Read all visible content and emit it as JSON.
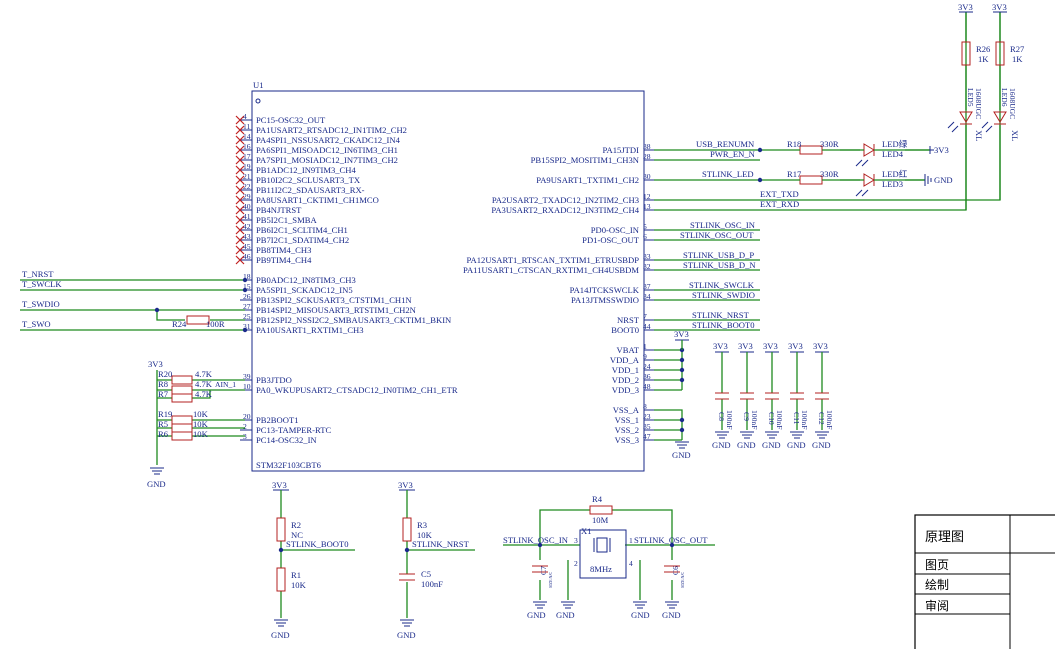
{
  "u1": {
    "ref": "U1",
    "part": "STM32F103CBT6",
    "left_pins": [
      {
        "name": "PC15-OSC32_OUT",
        "num": "4",
        "nc": true
      },
      {
        "name": "PA1USART2_RTSADC12_IN1TIM2_CH2",
        "num": "11",
        "nc": true
      },
      {
        "name": "PA4SPI1_NSSUSART2_CKADC12_IN4",
        "num": "14",
        "nc": true
      },
      {
        "name": "PA6SPI1_MISOADC12_IN6TIM3_CH1",
        "num": "16",
        "nc": true
      },
      {
        "name": "PA7SPI1_MOSIADC12_IN7TIM3_CH2",
        "num": "17",
        "nc": true
      },
      {
        "name": "PB1ADC12_IN9TIM3_CH4",
        "num": "19",
        "nc": true
      },
      {
        "name": "PB10I2C2_SCLUSART3_TX",
        "num": "21",
        "nc": true
      },
      {
        "name": "PB11I2C2_SDAUSART3_RX-",
        "num": "22",
        "nc": true
      },
      {
        "name": "PA8USART1_CKTIM1_CH1MCO",
        "num": "29",
        "nc": true
      },
      {
        "name": "PB4NJTRST",
        "num": "40",
        "nc": true
      },
      {
        "name": "PB5I2C1_SMBA",
        "num": "41",
        "nc": true
      },
      {
        "name": "PB6I2C1_SCLTIM4_CH1",
        "num": "42",
        "nc": true
      },
      {
        "name": "PB7I2C1_SDATIM4_CH2",
        "num": "43",
        "nc": true
      },
      {
        "name": "PB8TIM4_CH3",
        "num": "45",
        "nc": true
      },
      {
        "name": "PB9TIM4_CH4",
        "num": "46",
        "nc": true
      },
      {
        "name": "PB0ADC12_IN8TIM3_CH3",
        "num": "18",
        "nc": false
      },
      {
        "name": "PA5SPI1_SCKADC12_IN5",
        "num": "15",
        "nc": false
      },
      {
        "name": "PB13SPI2_SCKUSART3_CTSTIM1_CH1N",
        "num": "26",
        "nc": false
      },
      {
        "name": "PB14SPI2_MISOUSART3_RTSTIM1_CH2N",
        "num": "27",
        "nc": false
      },
      {
        "name": "PB12SPI2_NSSI2C2_SMBAUSART3_CKTIM1_BKIN",
        "num": "25",
        "nc": false
      },
      {
        "name": "PA10USART1_RXTIM1_CH3",
        "num": "31",
        "nc": false
      },
      {
        "name": "PB3JTDO",
        "num": "39",
        "nc": false
      },
      {
        "name": "PA0_WKUPUSART2_CTSADC12_IN0TIM2_CH1_ETR",
        "num": "10",
        "nc": false
      },
      {
        "name": "PB2BOOT1",
        "num": "20",
        "nc": false
      },
      {
        "name": "PC13-TAMPER-RTC",
        "num": "2",
        "nc": false
      },
      {
        "name": "PC14-OSC32_IN",
        "num": "3",
        "nc": false
      }
    ],
    "right_pins": [
      {
        "name": "PA15JTDI",
        "num": "38"
      },
      {
        "name": "PB15SPI2_MOSITIM1_CH3N",
        "num": "28"
      },
      {
        "name": "PA9USART1_TXTIM1_CH2",
        "num": "30"
      },
      {
        "name": "PA2USART2_TXADC12_IN2TIM2_CH3",
        "num": "12"
      },
      {
        "name": "PA3USART2_RXADC12_IN3TIM2_CH4",
        "num": "13"
      },
      {
        "name": "PD0-OSC_IN",
        "num": "5"
      },
      {
        "name": "PD1-OSC_OUT",
        "num": "6"
      },
      {
        "name": "PA12USART1_RTSCAN_TXTIM1_ETRUSBDP",
        "num": "33"
      },
      {
        "name": "PA11USART1_CTSCAN_RXTIM1_CH4USBDM",
        "num": "32"
      },
      {
        "name": "PA14JTCKSWCLK",
        "num": "37"
      },
      {
        "name": "PA13JTMSSWDIO",
        "num": "34"
      },
      {
        "name": "NRST",
        "num": "7"
      },
      {
        "name": "BOOT0",
        "num": "44"
      },
      {
        "name": "VBAT",
        "num": "1"
      },
      {
        "name": "VDD_A",
        "num": "9"
      },
      {
        "name": "VDD_1",
        "num": "24"
      },
      {
        "name": "VDD_2",
        "num": "36"
      },
      {
        "name": "VDD_3",
        "num": "48"
      },
      {
        "name": "VSS_A",
        "num": "8"
      },
      {
        "name": "VSS_1",
        "num": "23"
      },
      {
        "name": "VSS_2",
        "num": "35"
      },
      {
        "name": "VSS_3",
        "num": "47"
      }
    ]
  },
  "nets": {
    "usb_renumn": "USB_RENUMN",
    "pwr_en_n": "PWR_EN_N",
    "stlink_led": "STLINK_LED",
    "ext_txd": "EXT_TXD",
    "ext_rxd": "EXT_RXD",
    "stlink_osc_in": "STLINK_OSC_IN",
    "stlink_osc_out": "STLINK_OSC_OUT",
    "stlink_usb_d_p": "STLINK_USB_D_P",
    "stlink_usb_d_n": "STLINK_USB_D_N",
    "stlink_swclk": "STLINK_SWCLK",
    "stlink_swdio": "STLINK_SWDIO",
    "stlink_nrst": "STLINK_NRST",
    "stlink_boot0": "STLINK_BOOT0",
    "t_nrst": "T_NRST",
    "t_swclk": "T_SWCLK",
    "t_swdio": "T_SWDIO",
    "t_swo": "T_SWO",
    "ain_1": "AIN_1"
  },
  "power": {
    "v3v3": "3V3",
    "gnd": "GND"
  },
  "components": {
    "r18": {
      "ref": "R18",
      "value": "330R"
    },
    "r17": {
      "ref": "R17",
      "value": "330R"
    },
    "led4": {
      "ref": "LED4",
      "label": "LED绿"
    },
    "led3": {
      "ref": "LED3",
      "label": "LED红"
    },
    "r26": {
      "ref": "R26",
      "value": "1K"
    },
    "r27": {
      "ref": "R27",
      "value": "1K"
    },
    "led5": {
      "ref": "LED5",
      "value": "1608UGC"
    },
    "led6": {
      "ref": "LED6",
      "value": "1608UGC"
    },
    "led_tag": "XL",
    "r24": {
      "ref": "R24",
      "value": "100R"
    },
    "r20": {
      "ref": "R20",
      "value": "4.7K"
    },
    "r8": {
      "ref": "R8",
      "value": "4.7K"
    },
    "r7": {
      "ref": "R7",
      "value": "4.7K"
    },
    "r19": {
      "ref": "R19",
      "value": "10K"
    },
    "r5": {
      "ref": "R5",
      "value": "10K"
    },
    "r6": {
      "ref": "R6",
      "value": "10K"
    },
    "caps": [
      {
        "ref": "C8",
        "value": "100nF"
      },
      {
        "ref": "C9",
        "value": "100nF"
      },
      {
        "ref": "C10",
        "value": "100nF"
      },
      {
        "ref": "C11",
        "value": "100nF"
      },
      {
        "ref": "C12",
        "value": "100nF"
      }
    ],
    "r2": {
      "ref": "R2",
      "value": "NC"
    },
    "r1": {
      "ref": "R1",
      "value": "10K"
    },
    "r3": {
      "ref": "R3",
      "value": "10K"
    },
    "c5": {
      "ref": "C5",
      "value": "100nF"
    },
    "r4": {
      "ref": "R4",
      "value": "10M"
    },
    "x1": {
      "ref": "X1",
      "value": "8MHz"
    },
    "c7": {
      "ref": "C7",
      "value": "SIZE:N/C"
    },
    "c6": {
      "ref": "C6",
      "value": "SIZE:N/C"
    }
  },
  "title_block": {
    "title": "原理图",
    "rows": [
      "图页",
      "绘制",
      "审阅"
    ]
  }
}
